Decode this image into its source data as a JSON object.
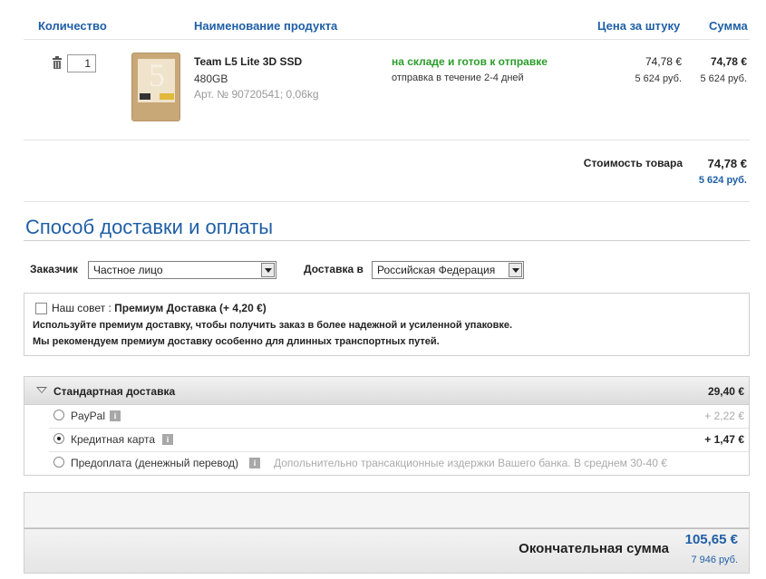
{
  "cart": {
    "headers": {
      "quantity": "Количество",
      "product": "Наименование продукта",
      "unit_price": "Цена за штуку",
      "sum": "Сумма"
    },
    "item": {
      "qty": "1",
      "name": "Team L5 Lite 3D SSD",
      "capacity": "480GB",
      "article": "Арт. № 90720541; 0,06kg",
      "stock": "на складе и готов к отправке",
      "shipping_time": "отправка в течение 2-4 дней",
      "unit_eur": "74,78 €",
      "unit_rub": "5 624 руб.",
      "sum_eur": "74,78 €",
      "sum_rub": "5 624 руб."
    },
    "subtotal": {
      "label": "Стоимость товара",
      "eur": "74,78 €",
      "rub": "5 624 руб."
    }
  },
  "delivery": {
    "title": "Способ доставки и оплаты",
    "customer_label": "Заказчик",
    "customer_value": "Частное лицо",
    "country_label": "Доставка в",
    "country_value": "Российская Федерация",
    "premium": {
      "prefix": "Наш совет : ",
      "title": "Премиум Доставка (+ 4,20 €)",
      "line1": "Используйте премиум доставку, чтобы получить заказ в более надежной и усиленной упаковке.",
      "line2": "Мы рекомендуем премиум доставку особенно для длинных транспортных путей."
    },
    "standard": {
      "name": "Стандартная доставка",
      "price": "29,40 €"
    },
    "payments": [
      {
        "label": "PayPal",
        "fee": "+ 2,22 €",
        "selected": false
      },
      {
        "label": "Кредитная карта",
        "fee": "+ 1,47 €",
        "selected": true
      },
      {
        "label": "Предоплата (денежный перевод)",
        "note": "Допольнительно трансакционные издержки Вашего банка. В среднем 30-40 €",
        "selected": false
      }
    ]
  },
  "total": {
    "label": "Окончательная сумма",
    "eur": "105,65 €",
    "rub": "7 946 руб."
  },
  "colors": {
    "accent": "#1f5fa6",
    "stock_green": "#2a9d2a"
  }
}
